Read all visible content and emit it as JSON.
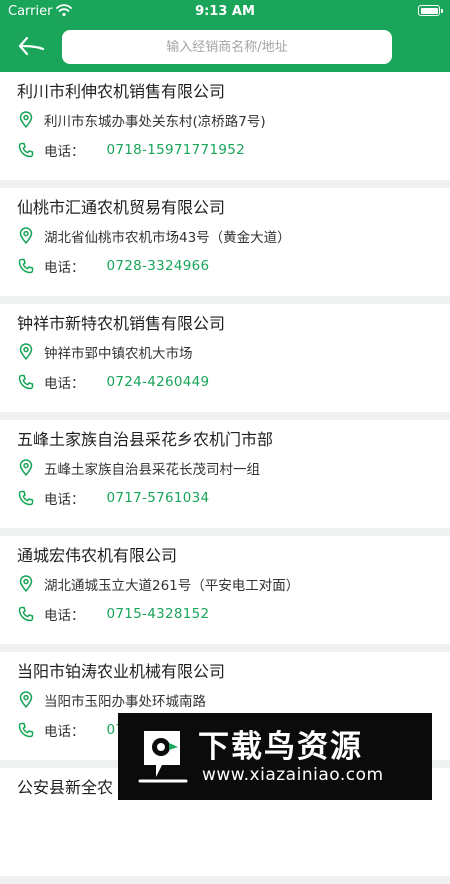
{
  "status_bar": {
    "carrier": "Carrier",
    "time": "9:13 AM"
  },
  "search": {
    "placeholder": "输入经销商名称/地址",
    "value": ""
  },
  "colors": {
    "accent": "#1aa55a",
    "background": "#eef1f0",
    "card": "#ffffff"
  },
  "phone_label": "电话：",
  "dealers": [
    {
      "name": "利川市利伸农机销售有限公司",
      "address": "利川市东城办事处关东村(凉桥路7号)",
      "phone": "0718-15971771952"
    },
    {
      "name": "仙桃市汇通农机贸易有限公司",
      "address": "湖北省仙桃市农机市场43号（黄金大道）",
      "phone": "0728-3324966"
    },
    {
      "name": "钟祥市新特农机销售有限公司",
      "address": "钟祥市郢中镇农机大市场",
      "phone": "0724-4260449"
    },
    {
      "name": "五峰土家族自治县采花乡农机门市部",
      "address": "五峰土家族自治县采花长茂司村一组",
      "phone": "0717-5761034"
    },
    {
      "name": "通城宏伟农机有限公司",
      "address": "湖北通城玉立大道261号（平安电工对面）",
      "phone": "0715-4328152"
    },
    {
      "name": "当阳市铂涛农业机械有限公司",
      "address": "当阳市玉阳办事处环城南路",
      "phone": "07"
    },
    {
      "name": "公安县新全农",
      "address": "",
      "phone": ""
    }
  ],
  "watermark": {
    "brand": "下载鸟资源",
    "site": "www.xiazainiao.com"
  },
  "icons": {
    "back": "arrow-left-icon",
    "address": "location-pin-icon",
    "phone": "phone-icon",
    "wifi": "wifi-icon",
    "battery": "battery-icon"
  }
}
